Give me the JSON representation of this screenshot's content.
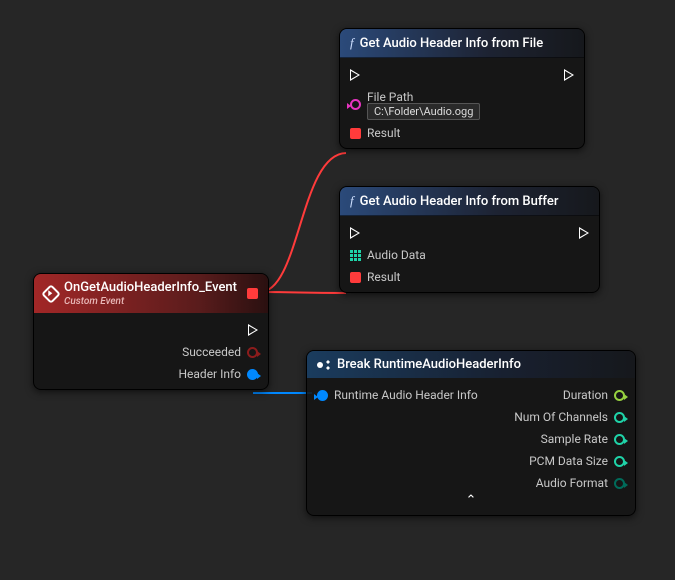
{
  "nodes": {
    "event": {
      "title": "OnGetAudioHeaderInfo_Event",
      "subtitle": "Custom Event",
      "outputs": {
        "succeeded": "Succeeded",
        "headerInfo": "Header Info"
      }
    },
    "getFromFile": {
      "title": "Get Audio Header Info from File",
      "inputs": {
        "filePath_label": "File Path",
        "filePath_value": "C:\\Folder\\Audio.ogg"
      },
      "outputs": {
        "result": "Result"
      }
    },
    "getFromBuffer": {
      "title": "Get Audio Header Info from Buffer",
      "inputs": {
        "audioData": "Audio Data"
      },
      "outputs": {
        "result": "Result"
      }
    },
    "break": {
      "title": "Break RuntimeAudioHeaderInfo",
      "inputs": {
        "rahi": "Runtime Audio Header Info"
      },
      "outputs": {
        "duration": "Duration",
        "numChannels": "Num Of Channels",
        "sampleRate": "Sample Rate",
        "pcmDataSize": "PCM Data Size",
        "audioFormat": "Audio Format"
      }
    }
  }
}
